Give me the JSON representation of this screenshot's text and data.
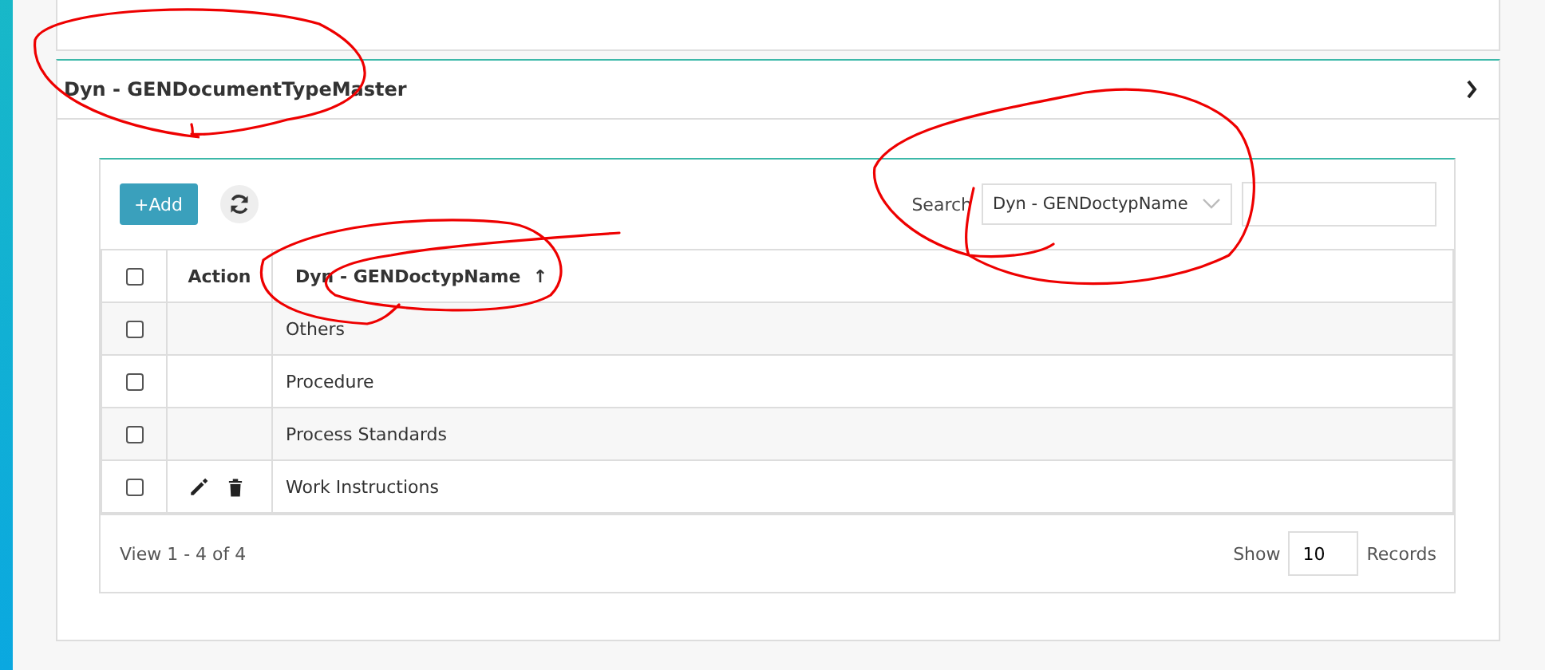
{
  "panel": {
    "title": "Dyn - GENDocumentTypeMaster",
    "expanded": false
  },
  "toolbar": {
    "add_button": "+Add",
    "search_label": "Search",
    "search_column": "Dyn - GENDoctypName"
  },
  "table": {
    "select_all_checked": false,
    "columns": [
      "Action",
      "Dyn - GENDoctypName"
    ],
    "sort_indicator": "↑",
    "rows": [
      {
        "checked": false,
        "has_actions": false,
        "name": "Others"
      },
      {
        "checked": false,
        "has_actions": false,
        "name": "Procedure"
      },
      {
        "checked": false,
        "has_actions": false,
        "name": "Process Standards"
      },
      {
        "checked": false,
        "has_actions": true,
        "name": "Work Instructions"
      }
    ]
  },
  "footer": {
    "summary": "View 1 - 4 of 4",
    "show_label": "Show",
    "page_size": "10",
    "records_label": "Records"
  },
  "markup": {
    "color": "#ee0000"
  }
}
